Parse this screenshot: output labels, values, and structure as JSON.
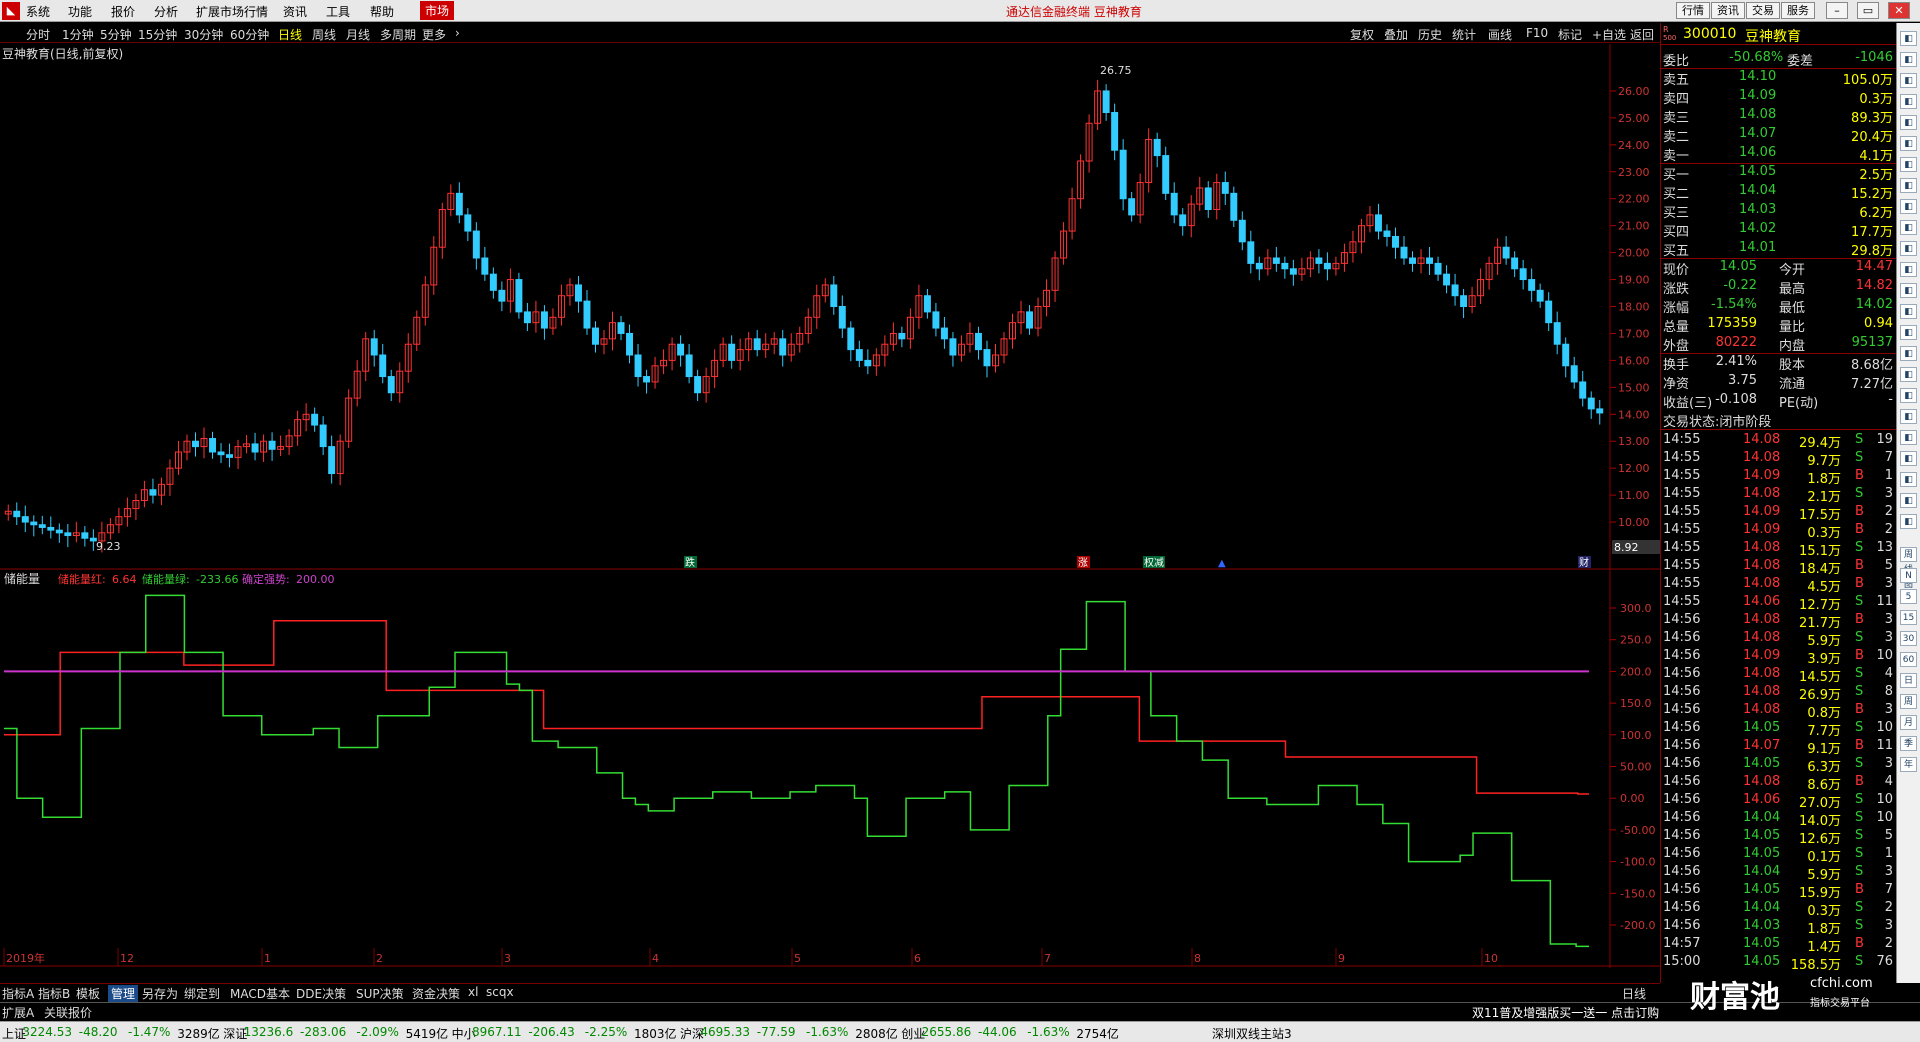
{
  "menubar": {
    "items": [
      "系统",
      "功能",
      "报价",
      "分析",
      "扩展市场行情",
      "资讯",
      "工具",
      "帮助"
    ],
    "market_label": "市场",
    "title": "通达信金融终端  豆神教育",
    "right_buttons": [
      "行情",
      "资讯",
      "交易",
      "服务"
    ]
  },
  "periods": [
    "分时",
    "1分钟",
    "5分钟",
    "15分钟",
    "30分钟",
    "60分钟",
    "日线",
    "周线",
    "月线",
    "多周期",
    "更多"
  ],
  "active_period": "日线",
  "tools": [
    "复权",
    "叠加",
    "历史",
    "统计",
    "画线",
    "F10",
    "标记",
    "+自选",
    "返回"
  ],
  "stock": {
    "code": "300010",
    "name": "豆神教育",
    "chart_title": "豆神教育(日线,前复权)",
    "price_badge": "8.92",
    "r_badge": "R",
    "r_sub": "500"
  },
  "quote": {
    "weibi_label": "委比",
    "weibi": "-50.68%",
    "weicha_label": "委差",
    "weicha": "-1046",
    "sell": [
      {
        "label": "卖五",
        "price": "14.10",
        "vol": "105.0万"
      },
      {
        "label": "卖四",
        "price": "14.09",
        "vol": "0.3万"
      },
      {
        "label": "卖三",
        "price": "14.08",
        "vol": "89.3万"
      },
      {
        "label": "卖二",
        "price": "14.07",
        "vol": "20.4万"
      },
      {
        "label": "卖一",
        "price": "14.06",
        "vol": "4.1万"
      }
    ],
    "buy": [
      {
        "label": "买一",
        "price": "14.05",
        "vol": "2.5万"
      },
      {
        "label": "买二",
        "price": "14.04",
        "vol": "15.2万"
      },
      {
        "label": "买三",
        "price": "14.03",
        "vol": "6.2万"
      },
      {
        "label": "买四",
        "price": "14.02",
        "vol": "17.7万"
      },
      {
        "label": "买五",
        "price": "14.01",
        "vol": "29.8万"
      }
    ],
    "stats": [
      {
        "l1": "现价",
        "v1": "14.05",
        "c1": "dn",
        "l2": "今开",
        "v2": "14.47",
        "c2": "up"
      },
      {
        "l1": "涨跌",
        "v1": "-0.22",
        "c1": "dn",
        "l2": "最高",
        "v2": "14.82",
        "c2": "up"
      },
      {
        "l1": "涨幅",
        "v1": "-1.54%",
        "c1": "dn",
        "l2": "最低",
        "v2": "14.02",
        "c2": "dn"
      },
      {
        "l1": "总量",
        "v1": "175359",
        "c1": "yl",
        "l2": "量比",
        "v2": "0.94",
        "c2": "yl"
      },
      {
        "l1": "外盘",
        "v1": "80222",
        "c1": "up",
        "l2": "内盘",
        "v2": "95137",
        "c2": "dn"
      }
    ],
    "stats2": [
      {
        "l1": "换手",
        "v1": "2.41%",
        "l2": "股本",
        "v2": "8.68亿"
      },
      {
        "l1": "净资",
        "v1": "3.75",
        "l2": "流通",
        "v2": "7.27亿"
      },
      {
        "l1": "收益(三)",
        "v1": "-0.108",
        "l2": "PE(动)",
        "v2": "-"
      }
    ],
    "trade_status": "交易状态:闭市阶段"
  },
  "ticks": [
    [
      "14:55",
      "14.08",
      "29.4万",
      "S",
      "19"
    ],
    [
      "14:55",
      "14.08",
      "9.7万",
      "S",
      "7"
    ],
    [
      "14:55",
      "14.09",
      "1.8万",
      "B",
      "1"
    ],
    [
      "14:55",
      "14.08",
      "2.1万",
      "S",
      "3"
    ],
    [
      "14:55",
      "14.09",
      "17.5万",
      "B",
      "2"
    ],
    [
      "14:55",
      "14.09",
      "0.3万",
      "B",
      "2"
    ],
    [
      "14:55",
      "14.08",
      "15.1万",
      "S",
      "13"
    ],
    [
      "14:55",
      "14.08",
      "18.4万",
      "B",
      "5"
    ],
    [
      "14:55",
      "14.08",
      "4.5万",
      "B",
      "3"
    ],
    [
      "14:55",
      "14.06",
      "12.7万",
      "S",
      "11"
    ],
    [
      "14:56",
      "14.08",
      "21.7万",
      "B",
      "3"
    ],
    [
      "14:56",
      "14.08",
      "5.9万",
      "S",
      "3"
    ],
    [
      "14:56",
      "14.09",
      "3.9万",
      "B",
      "10"
    ],
    [
      "14:56",
      "14.08",
      "14.5万",
      "S",
      "4"
    ],
    [
      "14:56",
      "14.08",
      "26.9万",
      "S",
      "8"
    ],
    [
      "14:56",
      "14.08",
      "0.8万",
      "B",
      "3"
    ],
    [
      "14:56",
      "14.05",
      "7.7万",
      "S",
      "10"
    ],
    [
      "14:56",
      "14.07",
      "9.1万",
      "B",
      "11"
    ],
    [
      "14:56",
      "14.05",
      "6.3万",
      "S",
      "3"
    ],
    [
      "14:56",
      "14.08",
      "8.6万",
      "B",
      "4"
    ],
    [
      "14:56",
      "14.06",
      "27.0万",
      "S",
      "10"
    ],
    [
      "14:56",
      "14.04",
      "14.0万",
      "S",
      "10"
    ],
    [
      "14:56",
      "14.05",
      "12.6万",
      "S",
      "5"
    ],
    [
      "14:56",
      "14.05",
      "0.1万",
      "S",
      "1"
    ],
    [
      "14:56",
      "14.04",
      "5.9万",
      "S",
      "3"
    ],
    [
      "14:56",
      "14.05",
      "15.9万",
      "B",
      "7"
    ],
    [
      "14:56",
      "14.04",
      "0.3万",
      "S",
      "2"
    ],
    [
      "14:56",
      "14.03",
      "1.8万",
      "S",
      "3"
    ],
    [
      "14:57",
      "14.05",
      "1.4万",
      "B",
      "2"
    ],
    [
      "15:00",
      "14.05",
      "158.5万",
      "S",
      "76"
    ]
  ],
  "side_tools": [
    "周线图",
    "N",
    "5",
    "15",
    "30",
    "60",
    "日",
    "周",
    "月",
    "季",
    "年"
  ],
  "indicator": {
    "name": "储能量",
    "red_label": "储能量红:",
    "red_value": "6.64",
    "green_label": "储能量绿:",
    "green_value": "-233.66",
    "purple_label": "确定强势:",
    "purple_value": "200.00"
  },
  "markers": {
    "die": "跌",
    "zhang": "涨",
    "ban": "权减",
    "cai": "财"
  },
  "price_labels": {
    "high": "26.75",
    "low": "9.23"
  },
  "x_labels": [
    "2019年",
    "12",
    "1",
    "2",
    "3",
    "4",
    "5",
    "6",
    "7",
    "8",
    "9",
    "10"
  ],
  "y_axis_price": [
    "26.00",
    "25.00",
    "24.00",
    "23.00",
    "22.00",
    "21.00",
    "20.00",
    "19.00",
    "18.00",
    "17.00",
    "16.00",
    "15.00",
    "14.00",
    "13.00",
    "12.00",
    "11.00",
    "10.00"
  ],
  "y_axis_ind": [
    "300.0",
    "250.0",
    "200.0",
    "150.0",
    "100.0",
    "50.00",
    "0.00",
    "-50.00",
    "-100.0",
    "-150.0",
    "-200.0"
  ],
  "bottom_tabs": [
    "指标A",
    "指标B",
    "模板",
    "管理",
    "另存为",
    "绑定到",
    "MACD基本",
    "DDE决策",
    "SUP决策",
    "资金决策",
    "xl",
    "scqx"
  ],
  "bottom_tab_selected": "管理",
  "day_label": "日线",
  "ext_tabs": [
    "扩展A",
    "关联报价"
  ],
  "news_ticker": "双11普及增强版买一送一 点击订购",
  "status": [
    {
      "name": "上证",
      "val": "3224.53",
      "chg": "-48.20",
      "pct": "-1.47%",
      "amt": "3289亿"
    },
    {
      "name": "深证",
      "val": "13236.6",
      "chg": "-283.06",
      "pct": "-2.09%",
      "amt": "5419亿"
    },
    {
      "name": "中小",
      "val": "8967.11",
      "chg": "-206.43",
      "pct": "-2.25%",
      "amt": "1803亿"
    },
    {
      "name": "沪深",
      "val": "4695.33",
      "chg": "-77.59",
      "pct": "-1.63%",
      "amt": "2808亿"
    },
    {
      "name": "创业",
      "val": "2655.86",
      "chg": "-44.06",
      "pct": "-1.63%",
      "amt": "2754亿"
    }
  ],
  "server": "深圳双线主站3",
  "watermark": {
    "brand": "财富池",
    "site": "cfchi.com",
    "sub": "指标交易平台"
  },
  "chart_data": {
    "type": "candlestick",
    "title": "豆神教育(日线,前复权)",
    "y_range_price": [
      9.0,
      27.0
    ],
    "closes": [
      10.4,
      10.2,
      10.0,
      9.9,
      9.8,
      9.7,
      9.6,
      9.5,
      9.6,
      9.4,
      9.3,
      9.6,
      9.9,
      10.2,
      10.5,
      10.8,
      11.2,
      11.0,
      11.4,
      12.0,
      12.6,
      13.0,
      12.8,
      13.1,
      12.6,
      12.5,
      12.4,
      12.8,
      12.9,
      12.6,
      13.0,
      12.7,
      12.8,
      13.2,
      13.8,
      14.0,
      13.6,
      12.8,
      11.8,
      13.0,
      14.6,
      15.6,
      16.8,
      16.2,
      15.4,
      14.8,
      15.6,
      16.6,
      17.6,
      18.8,
      20.2,
      21.6,
      22.2,
      21.4,
      20.8,
      19.8,
      19.2,
      18.6,
      18.2,
      19.0,
      17.8,
      17.4,
      17.8,
      17.2,
      17.6,
      18.4,
      18.8,
      18.2,
      17.2,
      16.6,
      16.8,
      17.4,
      17.0,
      16.2,
      15.4,
      15.2,
      15.8,
      16.0,
      16.6,
      16.2,
      15.4,
      14.8,
      15.4,
      16.0,
      16.6,
      16.0,
      16.4,
      16.8,
      16.4,
      16.6,
      16.8,
      16.2,
      16.6,
      17.0,
      17.6,
      18.4,
      18.8,
      18.0,
      17.2,
      16.4,
      16.0,
      15.8,
      16.2,
      16.6,
      17.0,
      16.8,
      17.6,
      18.4,
      17.8,
      17.2,
      16.8,
      16.2,
      16.6,
      17.0,
      16.4,
      15.8,
      16.2,
      16.8,
      17.4,
      17.8,
      17.2,
      18.0,
      18.6,
      19.8,
      20.8,
      22.0,
      23.4,
      24.8,
      26.0,
      25.2,
      23.8,
      22.0,
      21.4,
      22.6,
      24.2,
      23.6,
      22.2,
      21.4,
      21.0,
      21.8,
      22.4,
      21.6,
      22.6,
      22.2,
      21.2,
      20.4,
      19.6,
      19.4,
      19.8,
      19.6,
      19.4,
      19.2,
      19.4,
      19.8,
      19.6,
      19.4,
      19.6,
      20.0,
      20.4,
      21.0,
      21.4,
      20.8,
      20.6,
      20.2,
      19.8,
      19.6,
      19.8,
      19.6,
      19.2,
      18.8,
      18.4,
      18.0,
      18.4,
      19.0,
      19.6,
      20.2,
      19.8,
      19.4,
      19.0,
      18.6,
      18.2,
      17.4,
      16.6,
      15.8,
      15.2,
      14.6,
      14.2,
      14.05
    ],
    "series": [
      {
        "name": "储能量红",
        "values": [
          100,
          100,
          100,
          100,
          100,
          230,
          230,
          230,
          230,
          230,
          230,
          230,
          230,
          230,
          230,
          230,
          210,
          210,
          210,
          210,
          210,
          210,
          210,
          210,
          280,
          280,
          280,
          280,
          280,
          280,
          280,
          280,
          280,
          280,
          170,
          170,
          170,
          170,
          170,
          170,
          170,
          170,
          170,
          170,
          170,
          170,
          170,
          170,
          110,
          110,
          110,
          110,
          110,
          110,
          110,
          110,
          110,
          110,
          110,
          110,
          110,
          110,
          110,
          110,
          110,
          110,
          110,
          110,
          110,
          110,
          110,
          110,
          110,
          110,
          110,
          110,
          110,
          110,
          110,
          110,
          110,
          110,
          110,
          110,
          110,
          110,
          110,
          160,
          160,
          160,
          160,
          160,
          160,
          160,
          160,
          160,
          160,
          160,
          160,
          160,
          160,
          90,
          90,
          90,
          90,
          90,
          90,
          90,
          90,
          90,
          90,
          90,
          90,
          90,
          65,
          65,
          65,
          65,
          65,
          65,
          65,
          65,
          65,
          65,
          65,
          65,
          65,
          65,
          65,
          65,
          65,
          8,
          8,
          8,
          8,
          8,
          8,
          8,
          8,
          8,
          6.64
        ]
      },
      {
        "name": "储能量绿",
        "values": [
          110,
          0,
          0,
          -30,
          -30,
          -30,
          110,
          110,
          110,
          230,
          230,
          320,
          320,
          320,
          230,
          230,
          230,
          130,
          130,
          130,
          100,
          100,
          100,
          100,
          110,
          110,
          80,
          80,
          80,
          130,
          130,
          130,
          130,
          175,
          175,
          230,
          230,
          230,
          230,
          180,
          170,
          90,
          90,
          80,
          80,
          80,
          40,
          40,
          0,
          -10,
          -20,
          -20,
          0,
          0,
          0,
          10,
          10,
          10,
          0,
          0,
          0,
          10,
          10,
          20,
          20,
          20,
          0,
          -60,
          -60,
          -60,
          0,
          0,
          0,
          10,
          10,
          -50,
          -50,
          -50,
          20,
          20,
          20,
          130,
          235,
          235,
          310,
          310,
          310,
          200,
          200,
          130,
          130,
          90,
          90,
          60,
          60,
          0,
          0,
          0,
          -10,
          -10,
          -10,
          -10,
          20,
          20,
          20,
          -10,
          -10,
          -40,
          -40,
          -100,
          -100,
          -100,
          -100,
          -90,
          -55,
          -55,
          -55,
          -130,
          -130,
          -130,
          -230,
          -230,
          -233.66
        ]
      },
      {
        "name": "确定强势",
        "values": [
          200
        ]
      }
    ],
    "y_range_ind": [
      -230,
      330
    ]
  }
}
